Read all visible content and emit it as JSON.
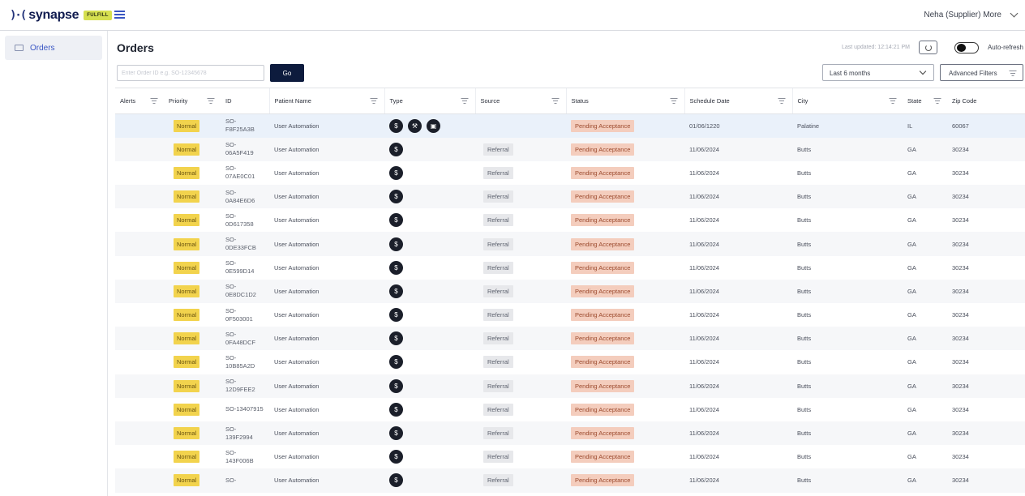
{
  "app": {
    "logo_mark": ")·(",
    "logo_text": "synapse",
    "logo_badge": "FULFILL",
    "user": "Neha (Supplier) More"
  },
  "sidebar": {
    "items": [
      {
        "label": "Orders",
        "icon": "orders-icon"
      }
    ]
  },
  "page": {
    "title": "Orders",
    "last_updated": "Last updated: 12:14:21 PM",
    "auto_refresh_label": "Auto-refresh",
    "search_placeholder": "Enter Order ID e.g. SO-12345678",
    "go_label": "Go",
    "range_selected": "Last 6 months",
    "advanced_filters_label": "Advanced Filters"
  },
  "colors": {
    "accent": "#3b57c4",
    "navy": "#0d1b3d",
    "priority": "#f2d34d",
    "status_pending": "#f4cdbd"
  },
  "table": {
    "columns": [
      "Alerts",
      "Priority",
      "ID",
      "Patient Name",
      "Type",
      "Source",
      "Status",
      "Schedule Date",
      "City",
      "State",
      "Zip Code"
    ],
    "rows": [
      {
        "priority": "Normal",
        "id_prefix": "SO-",
        "id_suffix": "F8F25A3B",
        "patient": "User Automation",
        "types": 3,
        "source": "",
        "status": "Pending Acceptance",
        "date": "01/06/1220",
        "city": "Palatine",
        "state": "IL",
        "zip": "60067"
      },
      {
        "priority": "Normal",
        "id_prefix": "SO-",
        "id_suffix": "06A5F419",
        "patient": "User Automation",
        "types": 1,
        "source": "Referral",
        "status": "Pending Acceptance",
        "date": "11/06/2024",
        "city": "Butts",
        "state": "GA",
        "zip": "30234"
      },
      {
        "priority": "Normal",
        "id_prefix": "SO-",
        "id_suffix": "07AE0C01",
        "patient": "User Automation",
        "types": 1,
        "source": "Referral",
        "status": "Pending Acceptance",
        "date": "11/06/2024",
        "city": "Butts",
        "state": "GA",
        "zip": "30234"
      },
      {
        "priority": "Normal",
        "id_prefix": "SO-",
        "id_suffix": "0A84E6D6",
        "patient": "User Automation",
        "types": 1,
        "source": "Referral",
        "status": "Pending Acceptance",
        "date": "11/06/2024",
        "city": "Butts",
        "state": "GA",
        "zip": "30234"
      },
      {
        "priority": "Normal",
        "id_prefix": "SO-",
        "id_suffix": "0D617358",
        "patient": "User Automation",
        "types": 1,
        "source": "Referral",
        "status": "Pending Acceptance",
        "date": "11/06/2024",
        "city": "Butts",
        "state": "GA",
        "zip": "30234"
      },
      {
        "priority": "Normal",
        "id_prefix": "SO-",
        "id_suffix": "0DE33FCB",
        "patient": "User Automation",
        "types": 1,
        "source": "Referral",
        "status": "Pending Acceptance",
        "date": "11/06/2024",
        "city": "Butts",
        "state": "GA",
        "zip": "30234"
      },
      {
        "priority": "Normal",
        "id_prefix": "SO-",
        "id_suffix": "0E599D14",
        "patient": "User Automation",
        "types": 1,
        "source": "Referral",
        "status": "Pending Acceptance",
        "date": "11/06/2024",
        "city": "Butts",
        "state": "GA",
        "zip": "30234"
      },
      {
        "priority": "Normal",
        "id_prefix": "SO-",
        "id_suffix": "0E8DC1D2",
        "patient": "User Automation",
        "types": 1,
        "source": "Referral",
        "status": "Pending Acceptance",
        "date": "11/06/2024",
        "city": "Butts",
        "state": "GA",
        "zip": "30234"
      },
      {
        "priority": "Normal",
        "id_prefix": "SO-",
        "id_suffix": "0F503001",
        "patient": "User Automation",
        "types": 1,
        "source": "Referral",
        "status": "Pending Acceptance",
        "date": "11/06/2024",
        "city": "Butts",
        "state": "GA",
        "zip": "30234"
      },
      {
        "priority": "Normal",
        "id_prefix": "SO-",
        "id_suffix": "0FA48DCF",
        "patient": "User Automation",
        "types": 1,
        "source": "Referral",
        "status": "Pending Acceptance",
        "date": "11/06/2024",
        "city": "Butts",
        "state": "GA",
        "zip": "30234"
      },
      {
        "priority": "Normal",
        "id_prefix": "SO-",
        "id_suffix": "10B85A2D",
        "patient": "User Automation",
        "types": 1,
        "source": "Referral",
        "status": "Pending Acceptance",
        "date": "11/06/2024",
        "city": "Butts",
        "state": "GA",
        "zip": "30234"
      },
      {
        "priority": "Normal",
        "id_prefix": "SO-",
        "id_suffix": "12D9FEE2",
        "patient": "User Automation",
        "types": 1,
        "source": "Referral",
        "status": "Pending Acceptance",
        "date": "11/06/2024",
        "city": "Butts",
        "state": "GA",
        "zip": "30234"
      },
      {
        "priority": "Normal",
        "id_prefix": "SO-13407915",
        "id_suffix": "",
        "patient": "User Automation",
        "types": 1,
        "source": "Referral",
        "status": "Pending Acceptance",
        "date": "11/06/2024",
        "city": "Butts",
        "state": "GA",
        "zip": "30234"
      },
      {
        "priority": "Normal",
        "id_prefix": "SO-",
        "id_suffix": "139F2994",
        "patient": "User Automation",
        "types": 1,
        "source": "Referral",
        "status": "Pending Acceptance",
        "date": "11/06/2024",
        "city": "Butts",
        "state": "GA",
        "zip": "30234"
      },
      {
        "priority": "Normal",
        "id_prefix": "SO-",
        "id_suffix": "143F006B",
        "patient": "User Automation",
        "types": 1,
        "source": "Referral",
        "status": "Pending Acceptance",
        "date": "11/06/2024",
        "city": "Butts",
        "state": "GA",
        "zip": "30234"
      },
      {
        "priority": "Normal",
        "id_prefix": "SO-",
        "id_suffix": "",
        "patient": "User Automation",
        "types": 1,
        "source": "Referral",
        "status": "Pending Acceptance",
        "date": "11/06/2024",
        "city": "Butts",
        "state": "GA",
        "zip": "30234"
      }
    ]
  }
}
